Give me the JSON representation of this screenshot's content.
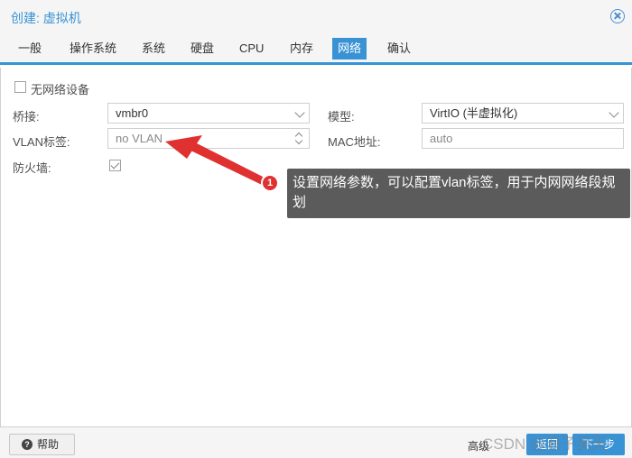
{
  "window": {
    "title": "创建: 虚拟机"
  },
  "tabs": [
    {
      "label": "一般"
    },
    {
      "label": "操作系统"
    },
    {
      "label": "系统"
    },
    {
      "label": "硬盘"
    },
    {
      "label": "CPU"
    },
    {
      "label": "内存"
    },
    {
      "label": "网络",
      "active": true
    },
    {
      "label": "确认"
    }
  ],
  "form": {
    "no_network_label": "无网络设备",
    "no_network_checked": false,
    "bridge_label": "桥接:",
    "bridge_value": "vmbr0",
    "vlan_label": "VLAN标签:",
    "vlan_placeholder": "no VLAN",
    "firewall_label": "防火墙:",
    "firewall_checked": true,
    "model_label": "模型:",
    "model_value": "VirtIO (半虚拟化)",
    "mac_label": "MAC地址:",
    "mac_value": "auto"
  },
  "annotation": {
    "number": "1",
    "text": "设置网络参数，可以配置vlan标签，用于内网网络段规划",
    "color": "#e03131"
  },
  "footer": {
    "help_label": "帮助",
    "advanced_label": "高级",
    "back_label": "返回",
    "next_label": "下一步"
  },
  "watermark": "CSDN @浪子吴天",
  "colors": {
    "accent": "#3892d4",
    "annotation_bg": "#5b5b5b"
  }
}
